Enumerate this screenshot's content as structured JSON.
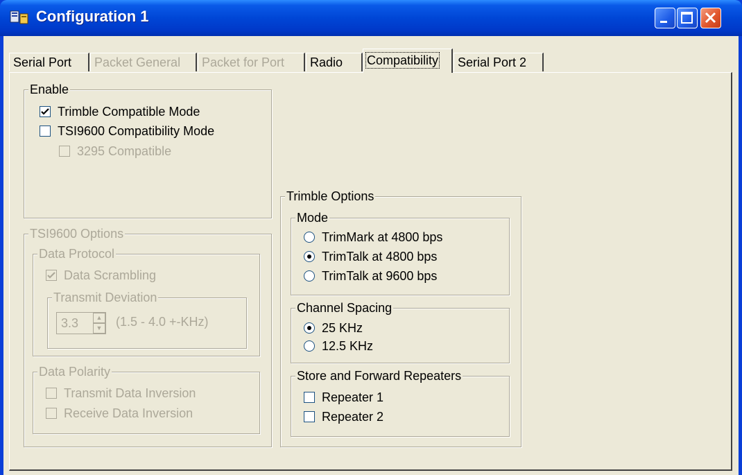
{
  "window": {
    "title": "Configuration 1",
    "icon": "configuration-app-icon"
  },
  "controls": {
    "minimize": "minimize-icon",
    "maximize": "maximize-icon",
    "close": "close-icon"
  },
  "tabs": [
    {
      "label": "Serial Port",
      "state": "enabled"
    },
    {
      "label": "Packet General",
      "state": "disabled"
    },
    {
      "label": "Packet for Port",
      "state": "disabled"
    },
    {
      "label": "Radio",
      "state": "enabled"
    },
    {
      "label": "Compatibility",
      "state": "active"
    },
    {
      "label": "Serial Port 2",
      "state": "enabled"
    }
  ],
  "enable": {
    "legend": "Enable",
    "trimble_compatible": {
      "label": "Trimble Compatible Mode",
      "checked": true
    },
    "tsi9600_compatibility": {
      "label": "TSI9600 Compatibility Mode",
      "checked": false
    },
    "compatible_3295": {
      "label": "3295 Compatible",
      "checked": false,
      "disabled": true
    }
  },
  "tsi9600": {
    "legend": "TSI9600 Options",
    "data_protocol": {
      "legend": "Data Protocol",
      "data_scrambling": {
        "label": "Data Scrambling",
        "checked": true,
        "disabled": true
      },
      "transmit_deviation": {
        "legend": "Transmit Deviation",
        "value": "3.3",
        "range": "(1.5 - 4.0 +-KHz)"
      }
    },
    "data_polarity": {
      "legend": "Data Polarity",
      "transmit_inversion": {
        "label": "Transmit Data Inversion",
        "checked": false
      },
      "receive_inversion": {
        "label": "Receive Data Inversion",
        "checked": false
      }
    }
  },
  "trimble": {
    "legend": "Trimble Options",
    "mode": {
      "legend": "Mode",
      "options": [
        {
          "label": "TrimMark at 4800 bps",
          "selected": false
        },
        {
          "label": "TrimTalk at 4800 bps",
          "selected": true
        },
        {
          "label": "TrimTalk at 9600 bps",
          "selected": false
        }
      ]
    },
    "channel_spacing": {
      "legend": "Channel Spacing",
      "options": [
        {
          "label": "25 KHz",
          "selected": true
        },
        {
          "label": "12.5 KHz",
          "selected": false
        }
      ]
    },
    "repeaters": {
      "legend": "Store and Forward Repeaters",
      "repeater1": {
        "label": "Repeater 1",
        "checked": false
      },
      "repeater2": {
        "label": "Repeater 2",
        "checked": false
      }
    }
  }
}
